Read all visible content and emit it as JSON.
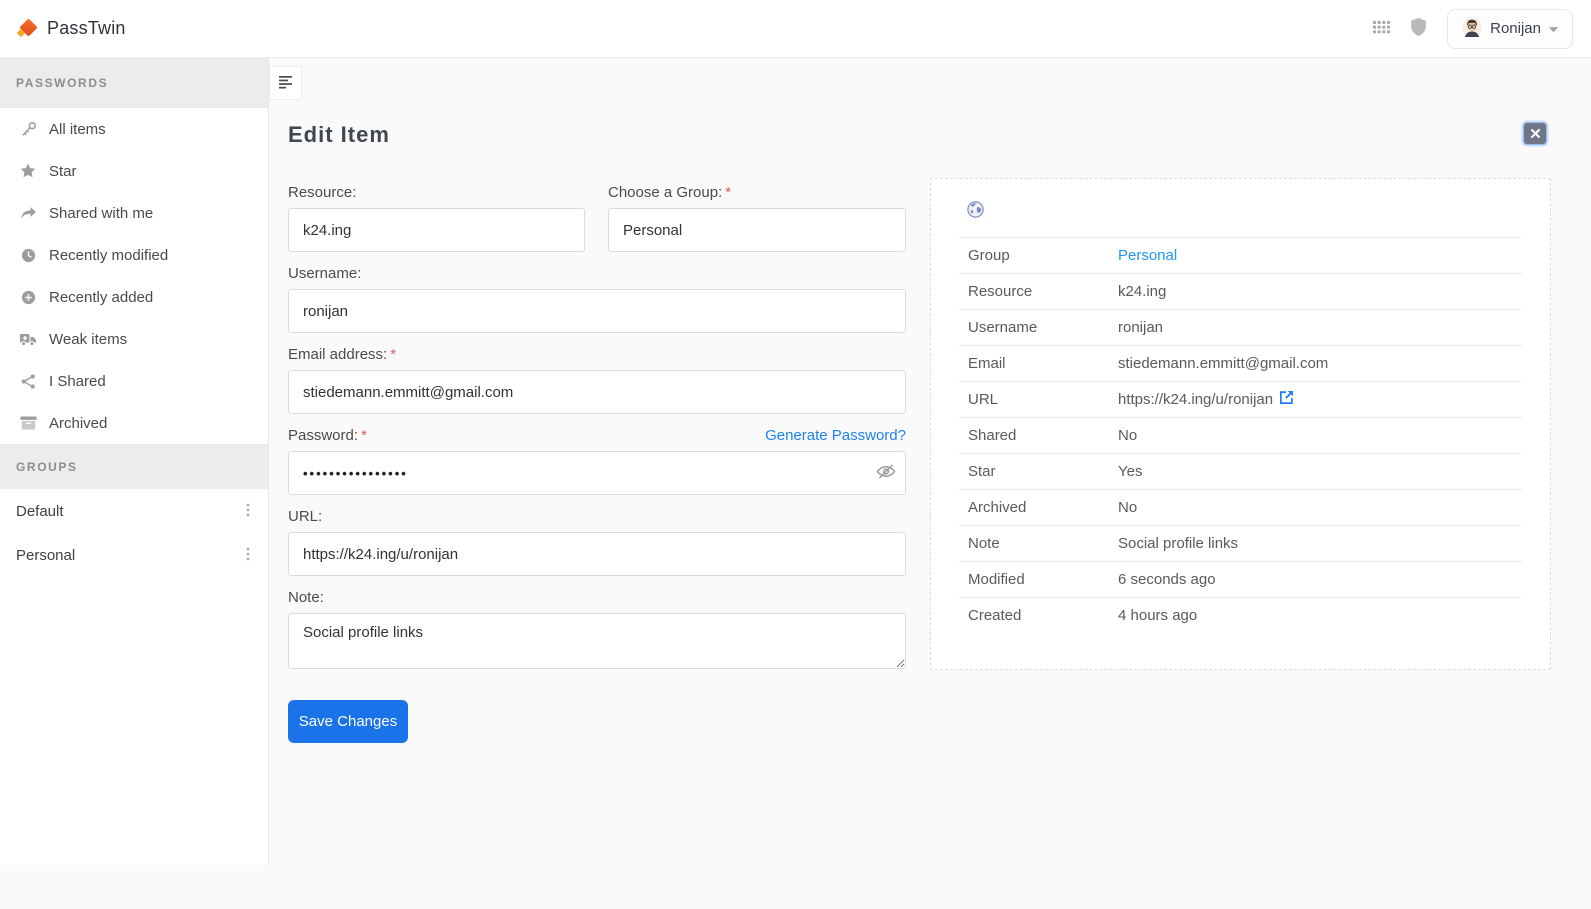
{
  "topbar": {
    "brand": "PassTwin",
    "user_name": "Ronijan",
    "icons": [
      "grid-icon",
      "shield-icon",
      "caret-down-icon"
    ]
  },
  "colors": {
    "brand_orange": "#e64a19",
    "brand_yellow": "#f9a825",
    "accent_blue": "#1a73e8",
    "link_blue": "#2196f3",
    "required_red": "#e05c5c",
    "close_button_gray": "#6e7687"
  },
  "sidebar": {
    "sections": [
      {
        "header": "PASSWORDS",
        "items": [
          {
            "label": "All items",
            "icon": "key-icon"
          },
          {
            "label": "Star",
            "icon": "star-icon"
          },
          {
            "label": "Shared with me",
            "icon": "forward-arrow-icon"
          },
          {
            "label": "Recently modified",
            "icon": "clock-icon"
          },
          {
            "label": "Recently added",
            "icon": "plus-circle-icon"
          },
          {
            "label": "Weak items",
            "icon": "ambulance-icon"
          },
          {
            "label": "I Shared",
            "icon": "share-alt-icon"
          },
          {
            "label": "Archived",
            "icon": "archive-icon"
          }
        ]
      },
      {
        "header": "GROUPS",
        "groups": [
          {
            "label": "Default"
          },
          {
            "label": "Personal"
          }
        ]
      }
    ]
  },
  "editor": {
    "title": "Edit Item",
    "required_mark": "*",
    "fields": {
      "resource": {
        "label": "Resource:",
        "value": "k24.ing"
      },
      "group": {
        "label": "Choose a Group:",
        "value": "Personal"
      },
      "username": {
        "label": "Username:",
        "value": "ronijan"
      },
      "email": {
        "label": "Email address:",
        "value": "stiedemann.emmitt@gmail.com"
      },
      "password": {
        "label": "Password:",
        "masked_value": "••••••••••••••••",
        "generate_link": "Generate Password?"
      },
      "url": {
        "label": "URL:",
        "value": "https://k24.ing/u/ronijan"
      },
      "note": {
        "label": "Note:",
        "value": "Social profile links"
      }
    },
    "save_label": "Save Changes"
  },
  "details": {
    "favicon": "globe-icon",
    "rows": [
      {
        "label": "Group",
        "value": "Personal"
      },
      {
        "label": "Resource",
        "value": "k24.ing"
      },
      {
        "label": "Username",
        "value": "ronijan"
      },
      {
        "label": "Email",
        "value": "stiedemann.emmitt@gmail.com"
      },
      {
        "label": "URL",
        "value": "https://k24.ing/u/ronijan"
      },
      {
        "label": "Shared",
        "value": "No"
      },
      {
        "label": "Star",
        "value": "Yes"
      },
      {
        "label": "Archived",
        "value": "No"
      },
      {
        "label": "Note",
        "value": "Social profile links"
      },
      {
        "label": "Modified",
        "value": "6 seconds ago"
      },
      {
        "label": "Created",
        "value": "4 hours ago"
      }
    ]
  }
}
